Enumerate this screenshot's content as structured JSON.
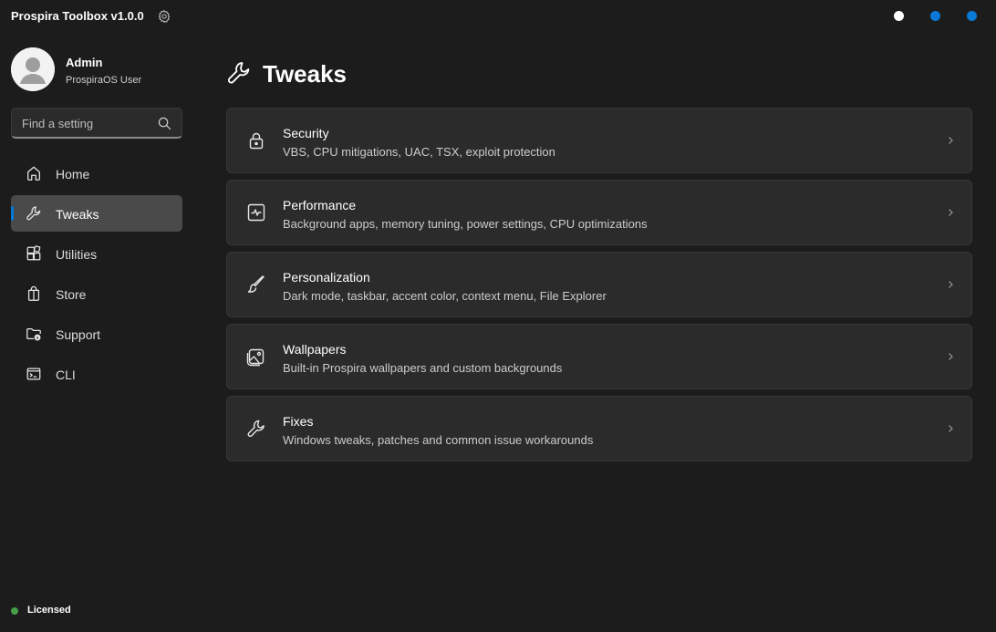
{
  "titlebar": {
    "app_title": "Prospira Toolbox v1.0.0",
    "settings_icon": "gear-icon",
    "window_dots": [
      {
        "name": "white-dot",
        "color": "#ffffff"
      },
      {
        "name": "blue-dot-1",
        "color": "#0a7ad6"
      },
      {
        "name": "blue-dot-2",
        "color": "#0a7ad6"
      }
    ]
  },
  "sidebar": {
    "profile": {
      "name": "Admin",
      "role": "ProspiraOS User",
      "avatar_icon": "user-avatar-icon"
    },
    "search": {
      "placeholder": "Find a setting",
      "value": "",
      "icon": "search-icon"
    },
    "nav": [
      {
        "label": "Home",
        "icon": "home-icon",
        "active": false
      },
      {
        "label": "Tweaks",
        "icon": "wrench-icon",
        "active": true
      },
      {
        "label": "Utilities",
        "icon": "apps-grid-icon",
        "active": false
      },
      {
        "label": "Store",
        "icon": "shopping-bag-icon",
        "active": false
      },
      {
        "label": "Support",
        "icon": "folder-info-icon",
        "active": false
      },
      {
        "label": "CLI",
        "icon": "terminal-icon",
        "active": false
      }
    ],
    "license": {
      "label": "Licensed",
      "status_color": "#45a049"
    }
  },
  "main": {
    "page_title": "Tweaks",
    "page_icon": "wrench-icon",
    "cards": [
      {
        "title": "Security",
        "description": "VBS, CPU mitigations, UAC, TSX, exploit protection",
        "icon": "lock-icon"
      },
      {
        "title": "Performance",
        "description": "Background apps, memory tuning, power settings, CPU optimizations",
        "icon": "pulse-icon"
      },
      {
        "title": "Personalization",
        "description": "Dark mode, taskbar, accent color, context menu, File Explorer",
        "icon": "brush-icon"
      },
      {
        "title": "Wallpapers",
        "description": "Built-in Prospira wallpapers and custom backgrounds",
        "icon": "image-icon"
      },
      {
        "title": "Fixes",
        "description": "Windows tweaks, patches and common issue workarounds",
        "icon": "wrench-icon"
      }
    ]
  },
  "colors": {
    "background": "#1c1c1c",
    "card": "#2b2b2b",
    "active_nav": "#4a4a4a",
    "accent": "#0078d4"
  }
}
